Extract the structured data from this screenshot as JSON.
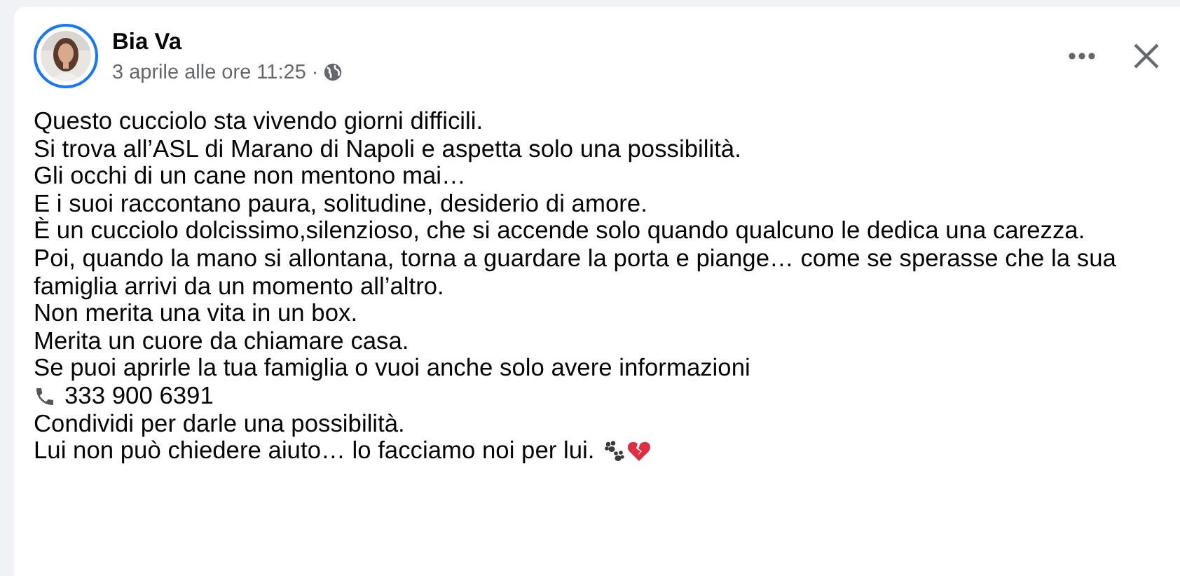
{
  "post": {
    "author": "Bia Va",
    "timestamp": "3 aprile alle ore 11:25",
    "separator": "·",
    "lines": [
      {
        "kind": "text",
        "text": "Questo cucciolo sta vivendo giorni difficili."
      },
      {
        "kind": "text",
        "text": "Si trova all’ASL di Marano di Napoli e aspetta solo una possibilità."
      },
      {
        "kind": "text",
        "text": "Gli occhi di un cane non mentono mai…"
      },
      {
        "kind": "text",
        "text": "E i suoi raccontano paura, solitudine, desiderio di amore."
      },
      {
        "kind": "text",
        "text": "È un cucciolo dolcissimo,silenzioso, che si accende solo quando qualcuno le dedica una carezza."
      },
      {
        "kind": "text",
        "text": "Poi, quando la mano si allontana, torna a guardare la porta e piange… come se sperasse che la sua famiglia arrivi da un momento all’altro."
      },
      {
        "kind": "text",
        "text": "Non merita una vita in un box."
      },
      {
        "kind": "text",
        "text": "Merita un cuore da chiamare casa."
      },
      {
        "kind": "text",
        "text": "Se puoi aprirle la tua famiglia  o vuoi anche solo avere informazioni"
      },
      {
        "kind": "phone",
        "text": "333 900 6391"
      },
      {
        "kind": "text",
        "text": "Condividi per darle una possibilità."
      },
      {
        "kind": "closing",
        "text": "Lui non può chiedere aiuto… lo facciamo noi per lui."
      }
    ]
  }
}
